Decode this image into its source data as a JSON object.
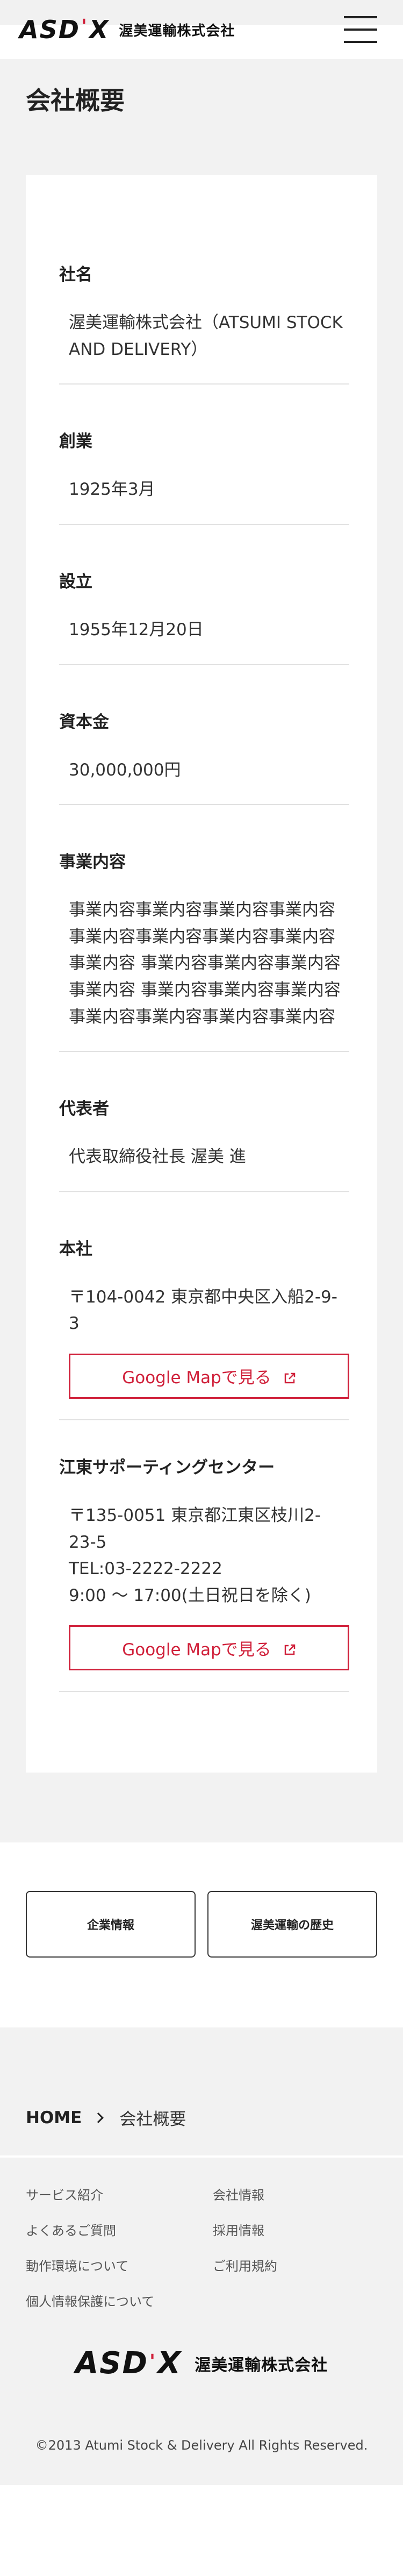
{
  "header": {
    "logo_mark": "ASD",
    "logo_mark_x": "X",
    "logo_tick": "'",
    "company": "渥美運輸株式会社",
    "menu_icon": "hamburger-icon"
  },
  "page": {
    "title": "会社概要"
  },
  "company_info": {
    "rows": [
      {
        "label": "社名",
        "value": "渥美運輸株式会社（ATSUMI STOCK AND DELIVERY）"
      },
      {
        "label": "創業",
        "value": "1925年3月"
      },
      {
        "label": "設立",
        "value": "1955年12月20日"
      },
      {
        "label": "資本金",
        "value": "30,000,000円"
      },
      {
        "label": "事業内容",
        "value": "事業内容事業内容事業内容事業内容 事業内容事業内容事業内容事業内容事業内容 事業内容事業内容事業内容事業内容 事業内容事業内容事業内容事業内容事業内容事業内容事業内容"
      },
      {
        "label": "代表者",
        "value": "代表取締役社長 渥美 進"
      }
    ],
    "head_office": {
      "label": "本社",
      "address": "〒104-0042 東京都中央区入船2-9-3",
      "map_button": "Google Mapで見る",
      "map_icon": "external-link-icon"
    },
    "support_center": {
      "label": "江東サポーティングセンター",
      "address": "〒135-0051 東京都江東区枝川2-23-5",
      "tel": "TEL:03-2222-2222",
      "hours": "9:00 ～ 17:00(土日祝日を除く)",
      "map_button": "Google Mapで見る",
      "map_icon": "external-link-icon"
    }
  },
  "links": {
    "corporate_info": "企業情報",
    "history": "渥美運輸の歴史"
  },
  "breadcrumb": {
    "home": "HOME",
    "current": "会社概要"
  },
  "footer": {
    "nav": [
      "サービス紹介",
      "会社情報",
      "よくあるご質問",
      "採用情報",
      "動作環境について",
      "ご利用規約",
      "個人情報保護について"
    ],
    "company": "渥美運輸株式会社",
    "copyright": "©2013 Atumi Stock & Delivery All Rights Reserved.",
    "accent_color": "#d0203a"
  }
}
